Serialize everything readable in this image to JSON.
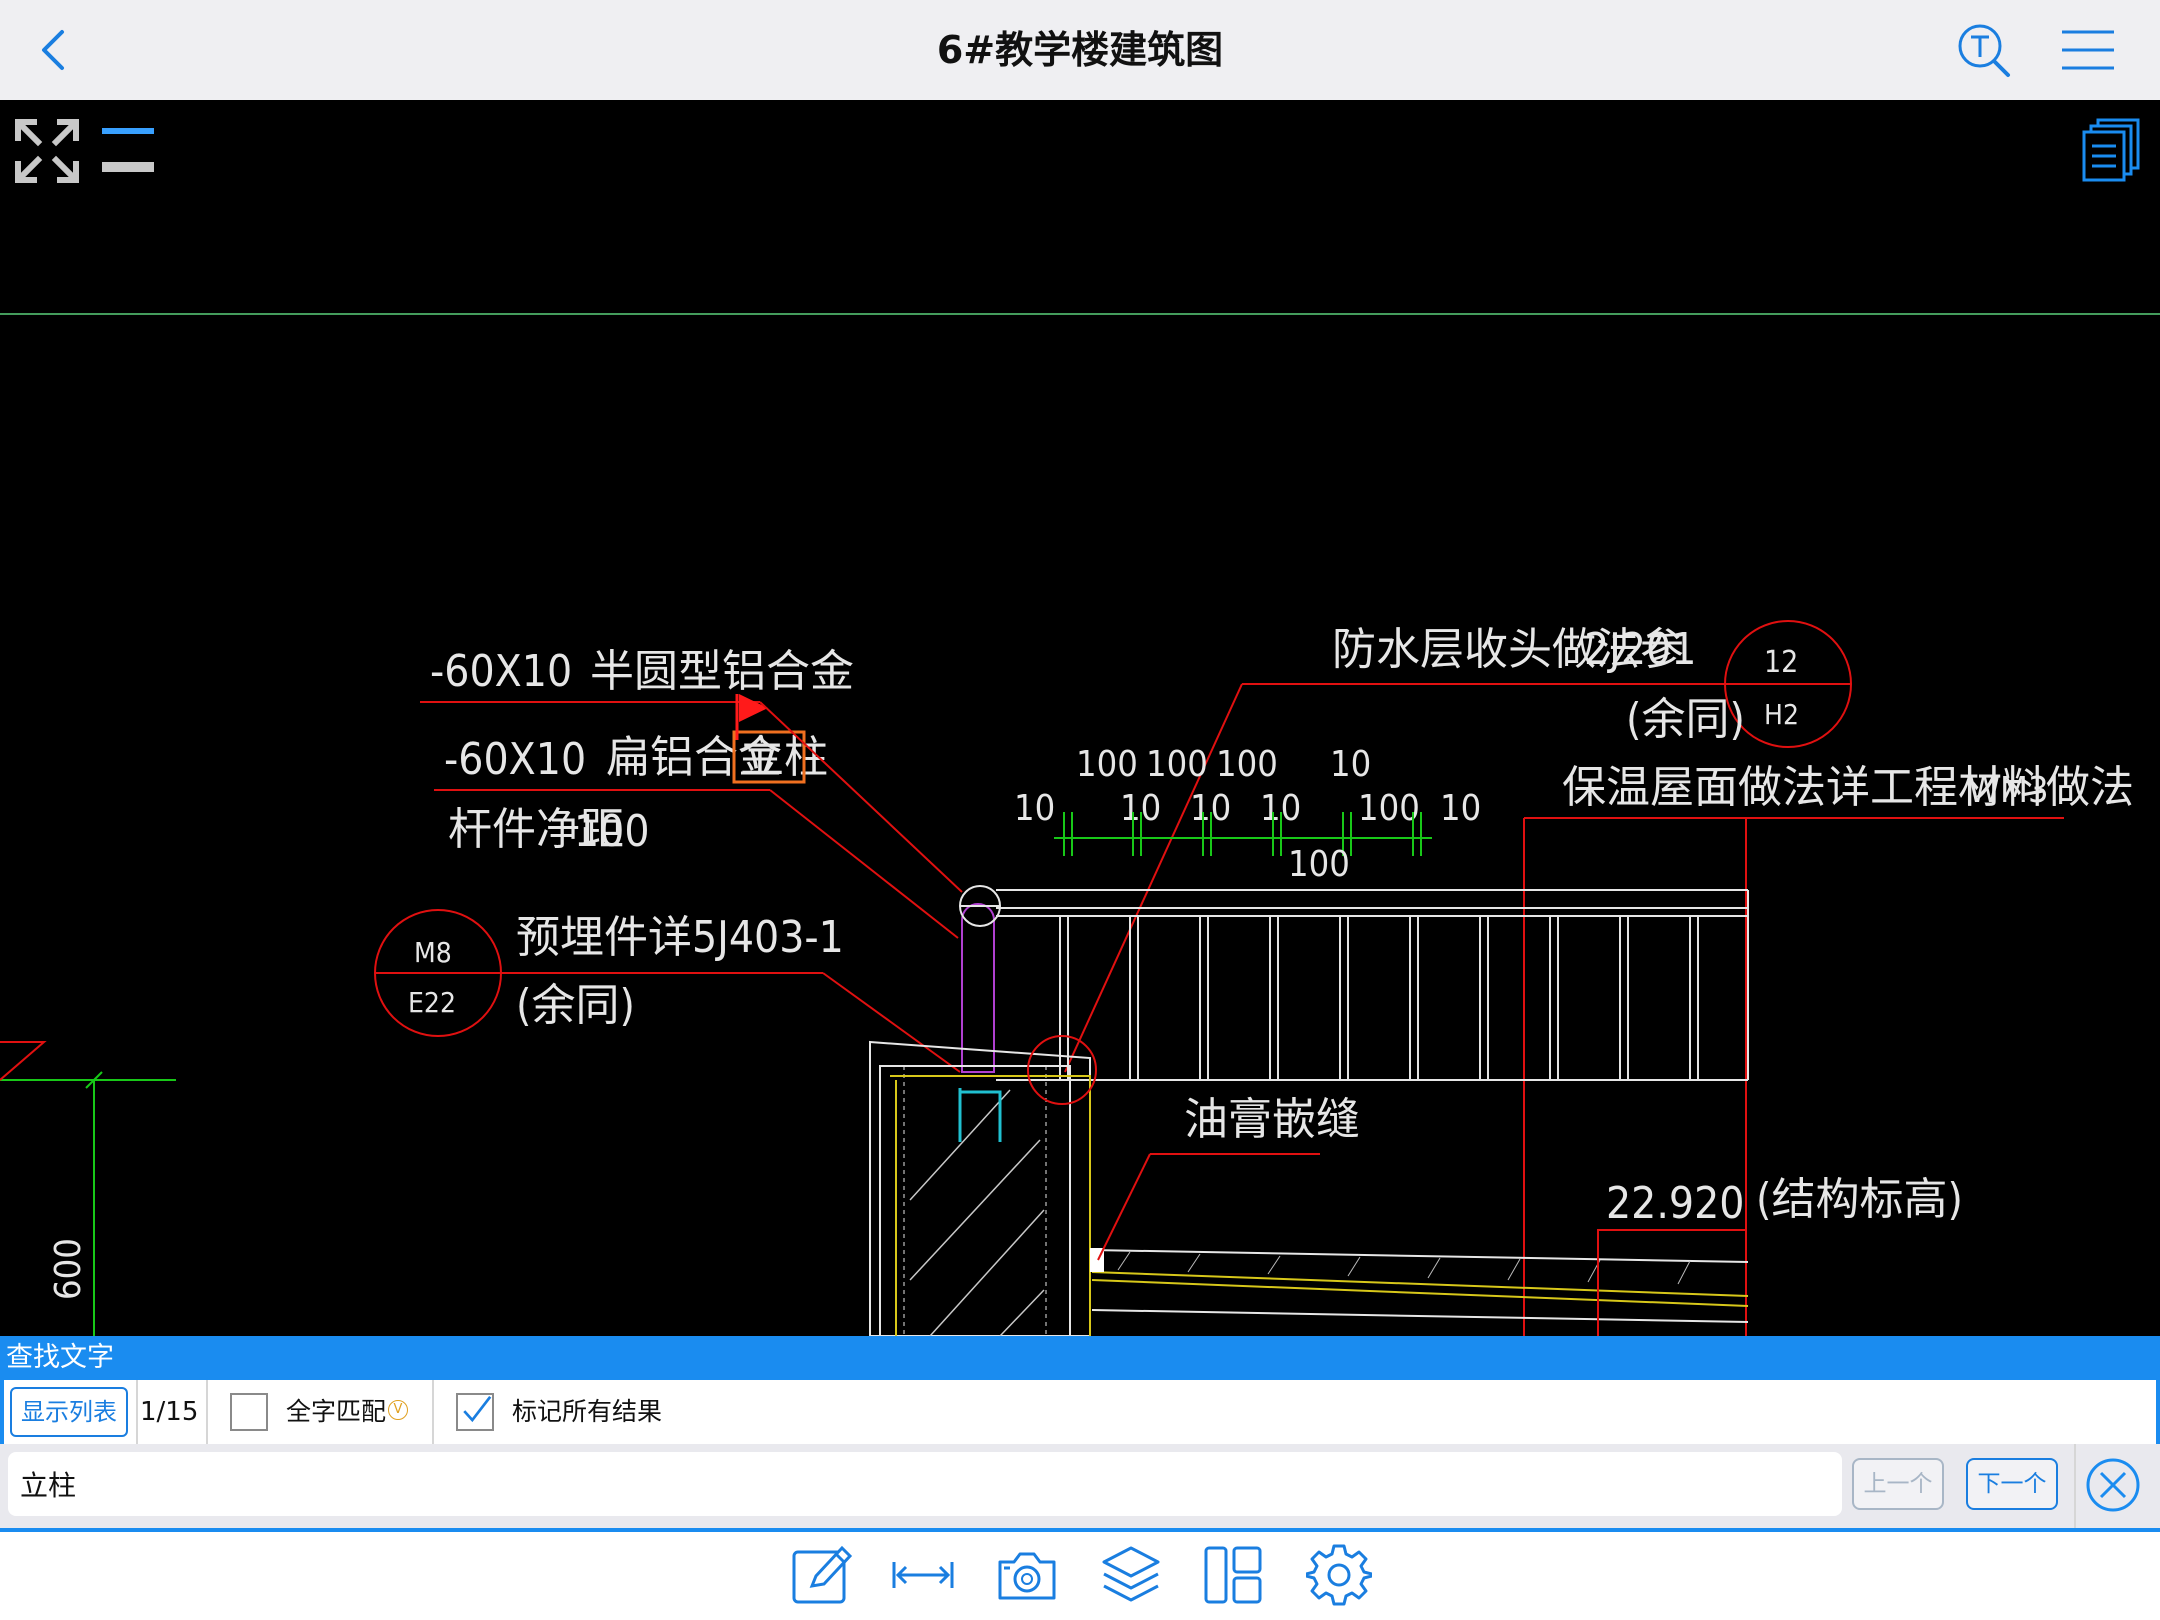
{
  "app": {
    "title": "6#教学楼建筑图"
  },
  "nav": {
    "icons": [
      "back-chevron-icon",
      "text-search-icon",
      "hamburger-menu-icon"
    ]
  },
  "drawing": {
    "labels": {
      "l1a": "-60X10",
      "l1b": "半圆型铝合金",
      "l2a": "-60X10",
      "l2b": "扁铝合金",
      "l2c": "立柱",
      "l3a": "杆件净距",
      "l3b": "100",
      "m8": "M8",
      "e22": "E22",
      "embedded": "预埋件详5J403-1",
      "same1": "(余同)",
      "waterproof_a": "防水层收头做法参",
      "waterproof_b": "2J201",
      "n12": "12",
      "h2": "H2",
      "same2": "(余同)",
      "insul_a": "保温屋面做法详工程材料做法",
      "insul_b": "WM3",
      "sealant": "油膏嵌缝",
      "elev": "22.920",
      "struct": "(结构标高)",
      "dim600": "600"
    },
    "dims_top": [
      "100",
      "100",
      "100",
      "10"
    ],
    "dims_mid": [
      "10",
      "10",
      "10",
      "10",
      "100",
      "10"
    ],
    "dim_mid_lead": "10",
    "dim_bottom": "100",
    "colors": {
      "red": "#e01010",
      "green": "#18c818",
      "white": "#e6e6e6",
      "yellow": "#d8c81a",
      "magenta": "#b040d0",
      "cyan": "#20c0d0",
      "orange": "#f07020",
      "flag": "#ff1a1a"
    }
  },
  "search": {
    "header": "查找文字",
    "show_list": "显示列表",
    "counter": "1/15",
    "whole_word": {
      "label": "全字匹配",
      "checked": false
    },
    "mark_all": {
      "label": "标记所有结果",
      "checked": true
    },
    "query": "立柱",
    "prev": "上一个",
    "next": "下一个"
  },
  "toolbar": {
    "icons": [
      "annotate-pencil-icon",
      "measure-icon",
      "camera-icon",
      "layers-icon",
      "layout-icon",
      "settings-gear-icon"
    ]
  },
  "ui_colors": {
    "accent": "#1a8cf0",
    "blue_icon": "#1a7ee0"
  }
}
